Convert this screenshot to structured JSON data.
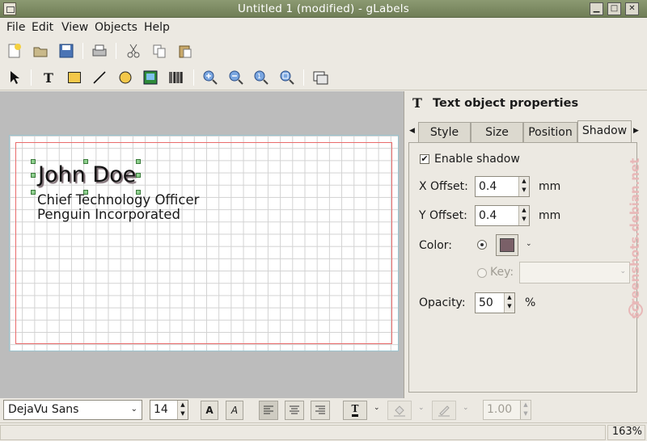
{
  "window": {
    "title": "Untitled 1 (modified) - gLabels"
  },
  "menus": [
    "File",
    "Edit",
    "View",
    "Objects",
    "Help"
  ],
  "label": {
    "name": "John Doe",
    "line1": "Chief Technology Officer",
    "line2": "Penguin Incorporated"
  },
  "panel": {
    "title": "Text object properties",
    "tabs": [
      "Style",
      "Size",
      "Position",
      "Shadow"
    ],
    "active_tab": "Shadow",
    "enable_shadow": "Enable shadow",
    "x_offset_label": "X Offset:",
    "x_offset": "0.4",
    "y_offset_label": "Y Offset:",
    "y_offset": "0.4",
    "unit": "mm",
    "color_label": "Color:",
    "shadow_color": "#7a6068",
    "key_label": "Key:",
    "opacity_label": "Opacity:",
    "opacity": "50",
    "opacity_unit": "%"
  },
  "bottom": {
    "font_family": "DejaVu Sans",
    "font_size": "14",
    "line_spacing": "1.00"
  },
  "status": {
    "zoom": "163%"
  },
  "watermark": "screenshots.debian.net"
}
